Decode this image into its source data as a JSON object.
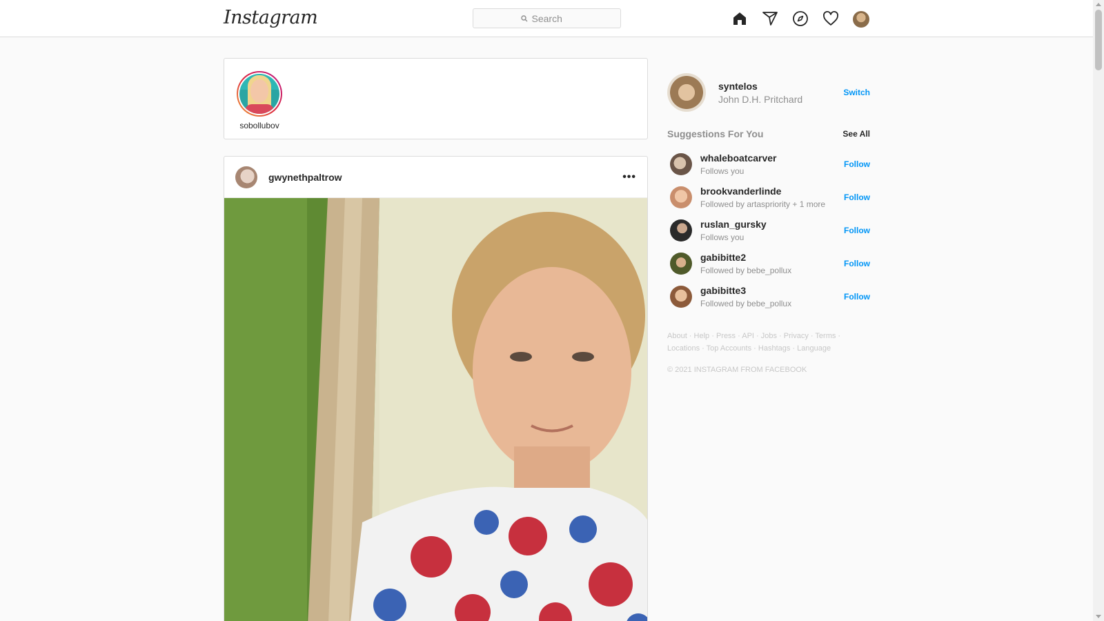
{
  "nav": {
    "logo_text": "Instagram",
    "search_placeholder": "Search",
    "icons": [
      "home-icon",
      "direct-icon",
      "explore-icon",
      "activity-heart-icon",
      "profile-avatar"
    ]
  },
  "stories": [
    {
      "username": "sobollubov"
    }
  ],
  "post": {
    "username": "gwynethpaltrow",
    "more_label": "•••"
  },
  "sidebar": {
    "me": {
      "username": "syntelos",
      "full_name": "John D.H. Pritchard",
      "switch_label": "Switch"
    },
    "suggestions_title": "Suggestions For You",
    "see_all_label": "See All",
    "suggestions": [
      {
        "username": "whaleboatcarver",
        "subtitle": "Follows you",
        "action": "Follow"
      },
      {
        "username": "brookvanderlinde",
        "subtitle": "Followed by artaspriority + 1 more",
        "action": "Follow"
      },
      {
        "username": "ruslan_gursky",
        "subtitle": "Follows you",
        "action": "Follow"
      },
      {
        "username": "gabibitte2",
        "subtitle": "Followed by bebe_pollux",
        "action": "Follow"
      },
      {
        "username": "gabibitte3",
        "subtitle": "Followed by bebe_pollux",
        "action": "Follow"
      }
    ],
    "footer_links_row1": [
      "About",
      "Help",
      "Press",
      "API",
      "Jobs",
      "Privacy",
      "Terms"
    ],
    "footer_links_row2": [
      "Locations",
      "Top Accounts",
      "Hashtags",
      "Language"
    ],
    "copyright": "© 2021 INSTAGRAM FROM FACEBOOK"
  },
  "colors": {
    "accent_blue": "#0095f6",
    "border": "#dbdbdb",
    "muted_text": "#8e8e8e",
    "background": "#fafafa"
  }
}
